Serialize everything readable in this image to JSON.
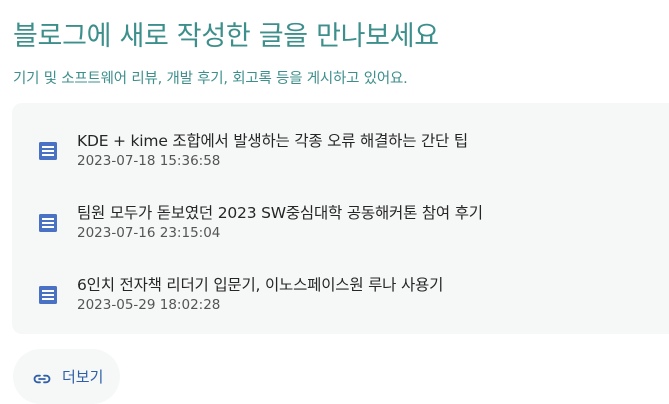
{
  "header": {
    "title": "블로그에 새로 작성한 글을 만나보세요",
    "subtitle": "기기 및 소프트웨어 리뷰, 개발 후기, 회고록 등을 게시하고 있어요."
  },
  "posts": [
    {
      "title": "KDE + kime 조합에서 발생하는 각종 오류 해결하는 간단 팁",
      "date": "2023-07-18 15:36:58",
      "icon": "article-icon"
    },
    {
      "title": "팀원 모두가 돋보였던 2023 SW중심대학 공동해커톤 참여 후기",
      "date": "2023-07-16 23:15:04",
      "icon": "article-icon"
    },
    {
      "title": "6인치 전자책 리더기 입문기, 이노스페이스원 루나 사용기",
      "date": "2023-05-29 18:02:28",
      "icon": "article-icon"
    }
  ],
  "more": {
    "label": "더보기",
    "icon": "link-icon"
  },
  "colors": {
    "heading": "#3d8f8c",
    "accent": "#2f5fa8",
    "card_background": "#f6f8f7",
    "icon": "#4a72c4"
  }
}
